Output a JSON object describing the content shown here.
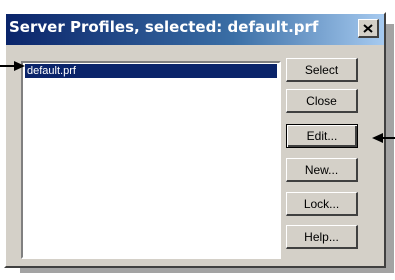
{
  "window": {
    "title": "Server Profiles, selected: default.prf"
  },
  "profiles": {
    "items": [
      "default.prf"
    ],
    "selected": "default.prf"
  },
  "buttons": {
    "select": "Select",
    "close": "Close",
    "edit": "Edit...",
    "new": "New...",
    "lock": "Lock...",
    "help": "Help..."
  },
  "icons": {
    "close": "close-icon",
    "pointer": "arrow-pointer-icon"
  },
  "colors": {
    "titlebar_start": "#0a246a",
    "titlebar_end": "#a6caf0",
    "selection": "#0a246a",
    "face": "#d4d0c8"
  }
}
